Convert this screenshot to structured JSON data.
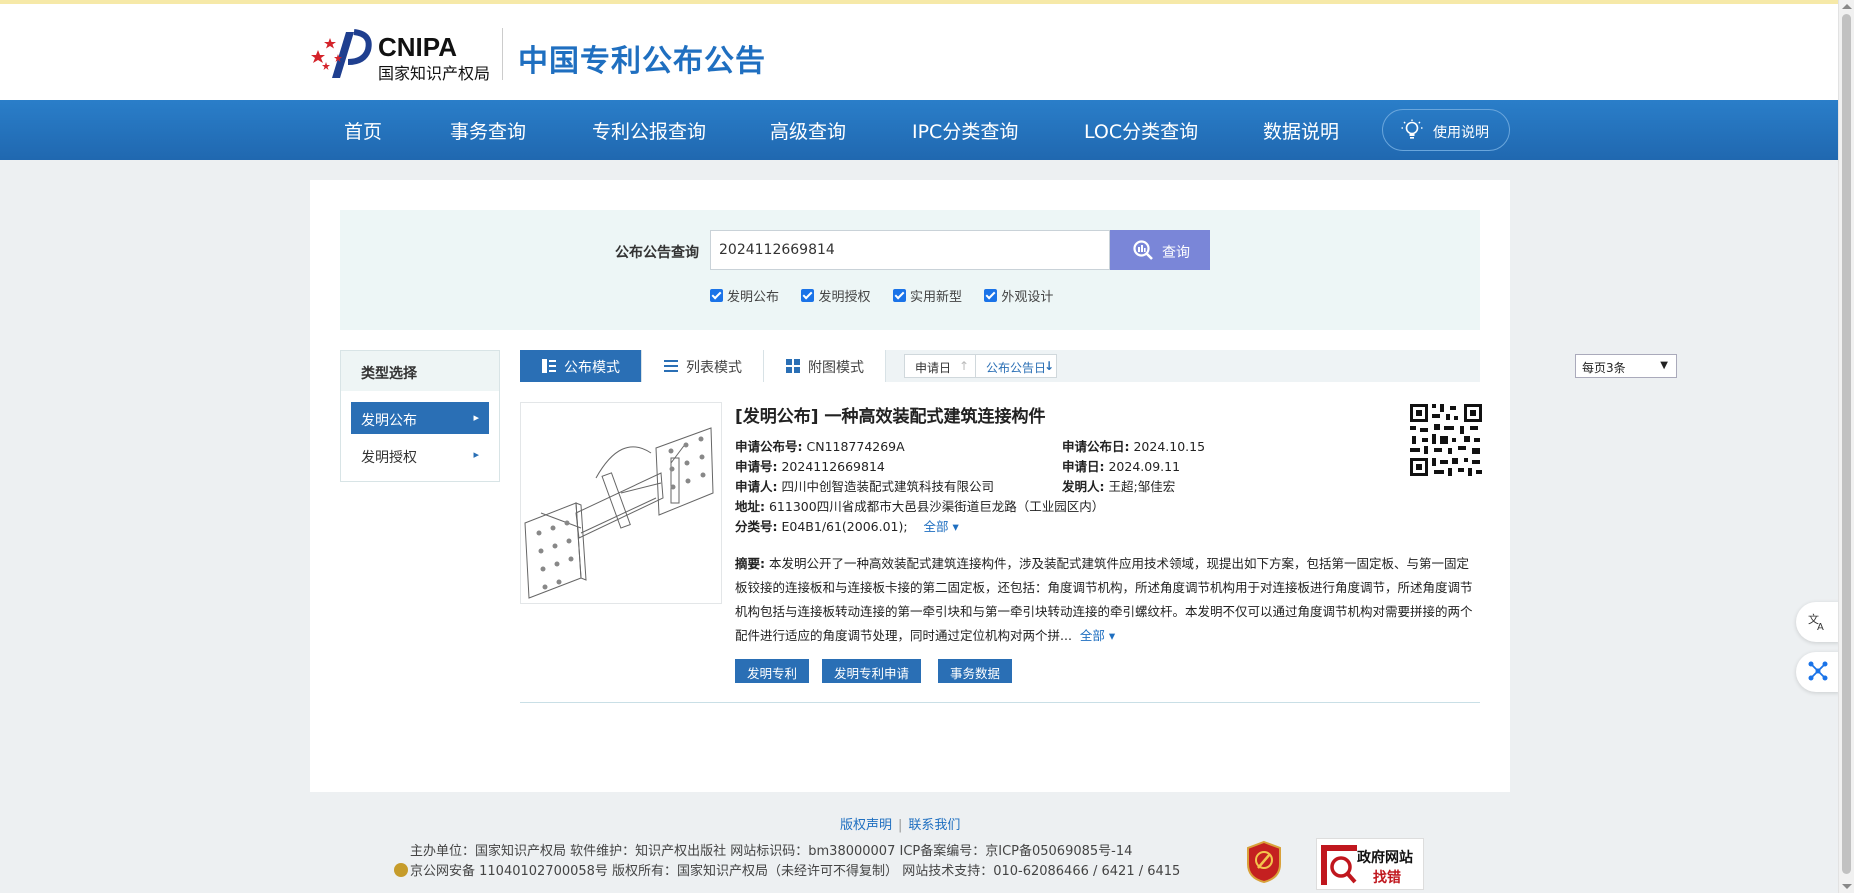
{
  "header": {
    "logo_en": "CNIPA",
    "logo_cn": "国家知识产权局",
    "site_title": "中国专利公布公告"
  },
  "nav": {
    "items": [
      "首页",
      "事务查询",
      "专利公报查询",
      "高级查询",
      "IPC分类查询",
      "LOC分类查询",
      "数据说明"
    ],
    "help_label": "使用说明"
  },
  "search": {
    "label": "公布公告查询",
    "value": "2024112669814",
    "button_label": "查询",
    "checkboxes": [
      "发明公布",
      "发明授权",
      "实用新型",
      "外观设计"
    ]
  },
  "sidebar": {
    "title": "类型选择",
    "items": [
      "发明公布",
      "发明授权"
    ]
  },
  "view_tabs": [
    "公布模式",
    "列表模式",
    "附图模式"
  ],
  "sort": {
    "apply_date": "申请日",
    "pub_date": "公布公告日"
  },
  "per_page": "每页3条",
  "result": {
    "title": "[发明公布] 一种高效装配式建筑连接构件",
    "pub_no_label": "申请公布号:",
    "pub_no": "CN118774269A",
    "pub_date_label": "申请公布日:",
    "pub_date": "2024.10.15",
    "app_no_label": "申请号:",
    "app_no": "2024112669814",
    "app_date_label": "申请日:",
    "app_date": "2024.09.11",
    "applicant_label": "申请人:",
    "applicant": "四川中创智造装配式建筑科技有限公司",
    "inventor_label": "发明人:",
    "inventor": "王超;邹佳宏",
    "address_label": "地址:",
    "address": "611300四川省成都市大邑县沙渠街道巨龙路（工业园区内）",
    "class_label": "分类号:",
    "class_no": "E04B1/61(2006.01);",
    "all_label": "全部",
    "abstract_label": "摘要:",
    "abstract": "本发明公开了一种高效装配式建筑连接构件，涉及装配式建筑件应用技术领域，现提出如下方案，包括第一固定板、与第一固定板铰接的连接板和与连接板卡接的第二固定板，还包括：角度调节机构，所述角度调节机构用于对连接板进行角度调节，所述角度调节机构包括与连接板转动连接的第一牵引块和与第一牵引块转动连接的牵引螺纹杆。本发明不仅可以通过角度调节机构对需要拼接的两个配件进行适应的角度调节处理，同时通过定位机构对两个拼...",
    "abstract_more": "全部",
    "buttons": [
      "发明专利",
      "发明专利申请",
      "事务数据"
    ]
  },
  "footer": {
    "links": [
      "版权声明",
      "联系我们"
    ],
    "line1": "主办单位：国家知识产权局    软件维护：知识产权出版社    网站标识码：bm38000007    ICP备案编号：京ICP备05069085号-14",
    "line2": "京公网安备 11040102700058号  版权所有：国家知识产权局（未经许可不得复制）    网站技术支持：010-62086466 / 6421 / 6415",
    "gov_line1": "政府网站",
    "gov_line2": "找错"
  },
  "colors": {
    "nav_blue": "#2068b0",
    "accent_blue": "#2a6fb5",
    "search_button": "#7a86d8"
  }
}
